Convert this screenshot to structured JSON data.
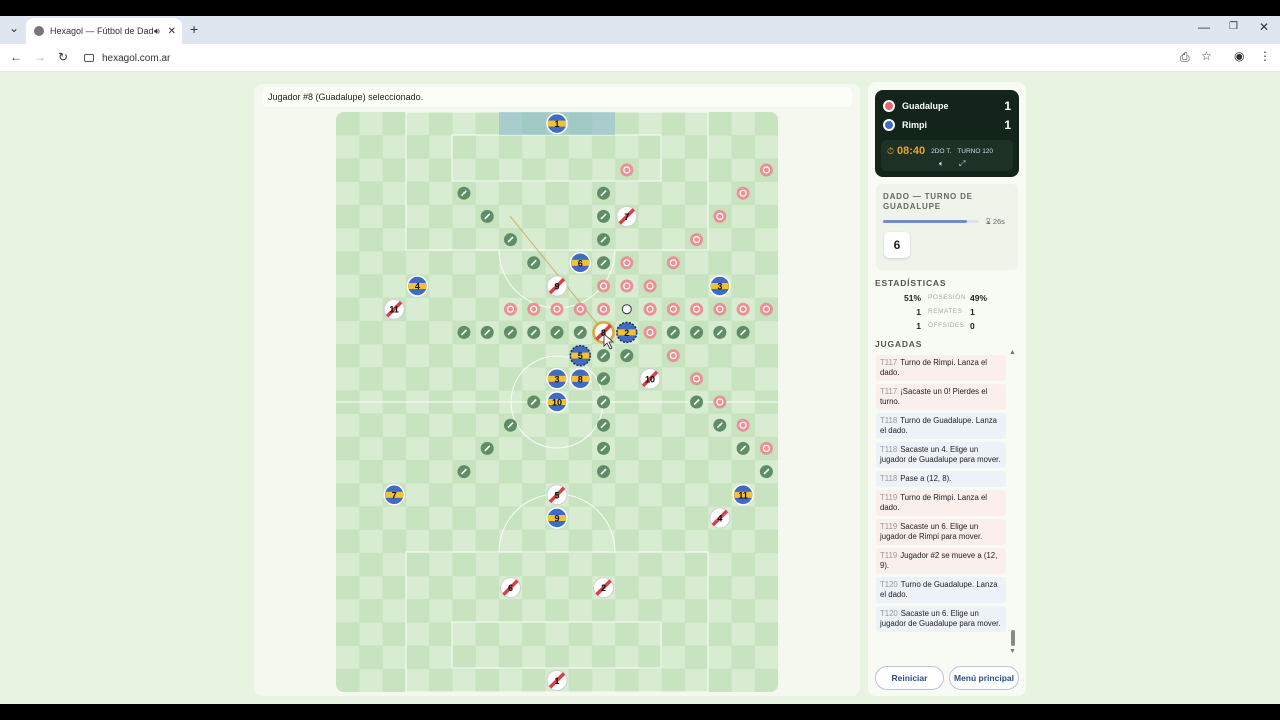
{
  "browser": {
    "tab_title": "Hexagol — Fútbol de Dado",
    "url": "hexagol.com.ar"
  },
  "status_message": "Jugador #8 (Guadalupe) seleccionado.",
  "score": {
    "home": {
      "name": "Guadalupe",
      "goals": "1",
      "color": "#e8676c"
    },
    "away": {
      "name": "Rimpi",
      "goals": "1",
      "color": "#3f6bc4"
    },
    "clock": "08:40",
    "period": "2DO T.",
    "turn": "TURNO 120"
  },
  "dice": {
    "title": "DADO — TURNO DE GUADALUPE",
    "timer": "26s",
    "timer_fraction": 0.87,
    "value": "6"
  },
  "stats": {
    "title": "ESTADÍSTICAS",
    "rows": [
      {
        "left": "51%",
        "label": "POSESIÓN",
        "right": "49%"
      },
      {
        "left": "1",
        "label": "REMATES",
        "right": "1"
      },
      {
        "left": "1",
        "label": "OFFSIDES",
        "right": "0"
      }
    ]
  },
  "plays_title": "JUGADAS",
  "plays": [
    {
      "turn": "T117",
      "text": "Turno de Rimpi. Lanza el dado.",
      "team": "r"
    },
    {
      "turn": "T117",
      "text": "¡Sacaste un 0! Pierdes el turno.",
      "team": "r"
    },
    {
      "turn": "T118",
      "text": "Turno de Guadalupe. Lanza el dado.",
      "team": "g"
    },
    {
      "turn": "T118",
      "text": "Sacaste un 4. Elige un jugador de Guadalupe para mover.",
      "team": "g"
    },
    {
      "turn": "T118",
      "text": "Pase a (12, 8).",
      "team": "g"
    },
    {
      "turn": "T119",
      "text": "Turno de Rimpi. Lanza el dado.",
      "team": "r"
    },
    {
      "turn": "T119",
      "text": "Sacaste un 6. Elige un jugador de Rimpi para mover.",
      "team": "r"
    },
    {
      "turn": "T119",
      "text": "Jugador #2 se mueve a (12, 9).",
      "team": "r"
    },
    {
      "turn": "T120",
      "text": "Turno de Guadalupe. Lanza el dado.",
      "team": "g"
    },
    {
      "turn": "T120",
      "text": "Sacaste un 6. Elige un jugador de Guadalupe para mover.",
      "team": "g"
    }
  ],
  "buttons": {
    "restart": "Reiniciar",
    "menu": "Menú principal"
  },
  "players": {
    "blue": [
      {
        "n": "1",
        "c": 9,
        "r": 0
      },
      {
        "n": "6",
        "c": 10,
        "r": 6
      },
      {
        "n": "4",
        "c": 3,
        "r": 7
      },
      {
        "n": "3",
        "c": 16,
        "r": 7
      },
      {
        "n": "2",
        "c": 12,
        "r": 9,
        "dashed": true
      },
      {
        "n": "5",
        "c": 10,
        "r": 10,
        "dashed": true
      },
      {
        "n": "3",
        "c": 9,
        "r": 11
      },
      {
        "n": "8",
        "c": 10,
        "r": 11
      },
      {
        "n": "10",
        "c": 9,
        "r": 12
      },
      {
        "n": "7",
        "c": 2,
        "r": 16
      },
      {
        "n": "11",
        "c": 17,
        "r": 16
      },
      {
        "n": "9",
        "c": 9,
        "r": 17
      }
    ],
    "red": [
      {
        "n": "7",
        "c": 12,
        "r": 4
      },
      {
        "n": "9",
        "c": 9,
        "r": 7
      },
      {
        "n": "11",
        "c": 2,
        "r": 8
      },
      {
        "n": "8",
        "c": 11,
        "r": 9,
        "selected": true
      },
      {
        "n": "10",
        "c": 13,
        "r": 11
      },
      {
        "n": "5",
        "c": 9,
        "r": 16
      },
      {
        "n": "4",
        "c": 16,
        "r": 17
      },
      {
        "n": "6",
        "c": 7,
        "r": 20
      },
      {
        "n": "2",
        "c": 11,
        "r": 20
      },
      {
        "n": "1",
        "c": 9,
        "r": 24
      }
    ]
  },
  "red_markers": [
    [
      12,
      2
    ],
    [
      18,
      2
    ],
    [
      17,
      3
    ],
    [
      16,
      4
    ],
    [
      15,
      5
    ],
    [
      11,
      6
    ],
    [
      12,
      6
    ],
    [
      14,
      6
    ],
    [
      11,
      7
    ],
    [
      12,
      7
    ],
    [
      13,
      7
    ],
    [
      7,
      8
    ],
    [
      8,
      8
    ],
    [
      9,
      8
    ],
    [
      10,
      8
    ],
    [
      11,
      8
    ],
    [
      13,
      8
    ],
    [
      14,
      8
    ],
    [
      15,
      8
    ],
    [
      16,
      8
    ],
    [
      17,
      8
    ],
    [
      18,
      8
    ],
    [
      13,
      9
    ],
    [
      14,
      10
    ],
    [
      15,
      11
    ],
    [
      16,
      12
    ],
    [
      17,
      13
    ],
    [
      18,
      14
    ]
  ],
  "green_markers": [
    [
      5,
      3
    ],
    [
      11,
      3
    ],
    [
      6,
      4
    ],
    [
      11,
      4
    ],
    [
      7,
      5
    ],
    [
      11,
      5
    ],
    [
      8,
      6
    ],
    [
      11,
      6
    ],
    [
      5,
      9
    ],
    [
      6,
      9
    ],
    [
      7,
      9
    ],
    [
      8,
      9
    ],
    [
      9,
      9
    ],
    [
      10,
      9
    ],
    [
      14,
      9
    ],
    [
      15,
      9
    ],
    [
      16,
      9
    ],
    [
      17,
      9
    ],
    [
      11,
      10
    ],
    [
      12,
      10
    ],
    [
      11,
      11
    ],
    [
      8,
      12
    ],
    [
      11,
      12
    ],
    [
      15,
      12
    ],
    [
      7,
      13
    ],
    [
      11,
      13
    ],
    [
      16,
      13
    ],
    [
      6,
      14
    ],
    [
      11,
      14
    ],
    [
      17,
      14
    ],
    [
      5,
      15
    ],
    [
      11,
      15
    ],
    [
      18,
      15
    ]
  ],
  "ball": {
    "c": 12,
    "r": 8
  }
}
